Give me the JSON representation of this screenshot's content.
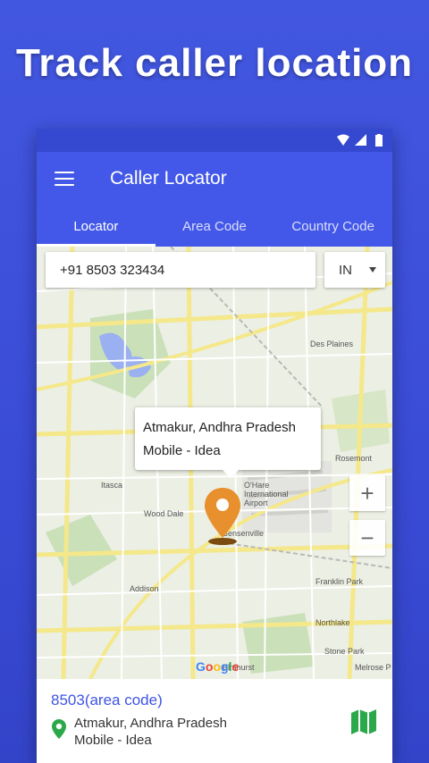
{
  "promo": {
    "title": "Track caller location"
  },
  "app": {
    "title": "Caller Locator"
  },
  "tabs": [
    {
      "label": "Locator",
      "active": true
    },
    {
      "label": "Area Code",
      "active": false
    },
    {
      "label": "Country Code",
      "active": false
    }
  ],
  "search": {
    "phone_value": "+91 8503 323434",
    "country": "IN"
  },
  "map": {
    "info_line1": "Atmakur, Andhra Pradesh",
    "info_line2": "Mobile - Idea",
    "zoom_in": "+",
    "zoom_out": "−",
    "google_letters": [
      "G",
      "o",
      "o",
      "g",
      "l",
      "e"
    ],
    "labels": [
      "Des Plaines",
      "Rosemont",
      "O'Hare International Airport",
      "Itasca",
      "Wood Dale",
      "Bensenville",
      "Addison",
      "Franklin Park",
      "Northlake",
      "Stone Park",
      "Melrose P",
      "Elmhurst"
    ]
  },
  "result": {
    "area_code": "8503(area code)",
    "location": "Atmakur, Andhra Pradesh",
    "carrier": "Mobile - Idea"
  },
  "colors": {
    "primary": "#4358e8",
    "status_bar": "#3448d0",
    "marker": "#e8902e",
    "location_pin": "#2aa84a",
    "area_code_text": "#3e54e2"
  },
  "icons": [
    "menu-icon",
    "wifi-icon",
    "signal-icon",
    "battery-icon",
    "location-marker-icon",
    "location-pin-icon",
    "map-icon"
  ]
}
